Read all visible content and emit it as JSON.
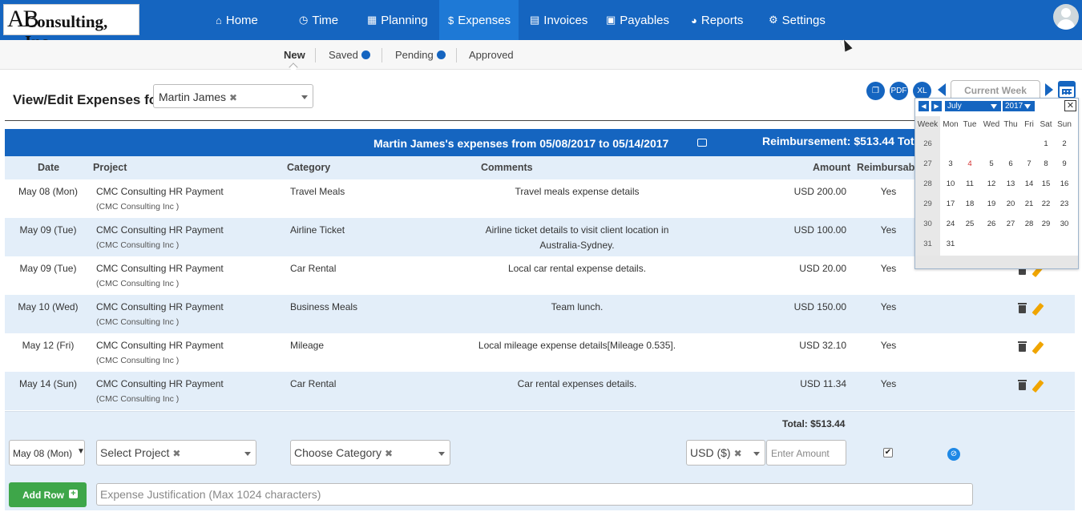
{
  "logo": {
    "initials": "AB",
    "name": "Consulting, Inc."
  },
  "nav": {
    "items": [
      {
        "label": "Home",
        "icon": "home-icon",
        "glyph": "⌂"
      },
      {
        "label": "Time",
        "icon": "clock-icon",
        "glyph": "◷"
      },
      {
        "label": "Planning",
        "icon": "calendar-check-icon",
        "glyph": "▦"
      },
      {
        "label": "Expenses",
        "icon": "dollar-icon",
        "glyph": "$"
      },
      {
        "label": "Invoices",
        "icon": "file-icon",
        "glyph": "▤"
      },
      {
        "label": "Payables",
        "icon": "money-icon",
        "glyph": "▣"
      },
      {
        "label": "Reports",
        "icon": "pie-chart-icon",
        "glyph": "◕"
      },
      {
        "label": "Settings",
        "icon": "gears-icon",
        "glyph": "⚙"
      }
    ],
    "active": "Expenses"
  },
  "subtabs": [
    {
      "label": "New"
    },
    {
      "label": "Saved"
    },
    {
      "label": "Pending"
    },
    {
      "label": "Approved"
    }
  ],
  "page": {
    "heading": "View/Edit Expenses for",
    "employee": "Martin James",
    "week_label": "Current Week"
  },
  "toolbar": {
    "copy_icon": "copy-icon",
    "pdf_icon": "pdf-icon",
    "excel_icon": "excel-icon"
  },
  "banner": {
    "title": "Martin James's expenses from  05/08/2017 to 05/14/2017",
    "reimbursement": "Reimbursement: $513.44  Tot"
  },
  "columns": [
    "Date",
    "Project",
    "Category",
    "Comments",
    "Amount",
    "Reimbursable"
  ],
  "rows": [
    {
      "date": "May 08 (Mon)",
      "project": "CMC Consulting HR Payment",
      "client": "(CMC Consulting Inc )",
      "category": "Travel Meals",
      "comment": "Travel meals expense details",
      "amount": "USD 200.00",
      "reimbursable": "Yes"
    },
    {
      "date": "May 09 (Tue)",
      "project": "CMC Consulting HR Payment",
      "client": "(CMC Consulting Inc )",
      "category": "Airline Ticket",
      "comment": "Airline ticket details to visit client location in Australia-Sydney.",
      "amount": "USD 100.00",
      "reimbursable": "Yes"
    },
    {
      "date": "May 09 (Tue)",
      "project": "CMC Consulting HR Payment",
      "client": "(CMC Consulting Inc )",
      "category": "Car Rental",
      "comment": "Local car rental expense details.",
      "amount": "USD 20.00",
      "reimbursable": "Yes"
    },
    {
      "date": "May 10 (Wed)",
      "project": "CMC Consulting HR Payment",
      "client": "(CMC Consulting Inc )",
      "category": "Business Meals",
      "comment": "Team lunch.",
      "amount": "USD 150.00",
      "reimbursable": "Yes"
    },
    {
      "date": "May 12 (Fri)",
      "project": "CMC Consulting HR Payment",
      "client": "(CMC Consulting Inc )",
      "category": "Mileage",
      "comment": "Local mileage expense details[Mileage 0.535].",
      "amount": "USD 32.10",
      "reimbursable": "Yes"
    },
    {
      "date": "May 14 (Sun)",
      "project": "CMC Consulting HR Payment",
      "client": "(CMC Consulting Inc )",
      "category": "Car Rental",
      "comment": "Car rental expenses details.",
      "amount": "USD 11.34",
      "reimbursable": "Yes"
    }
  ],
  "total": "Total: $513.44",
  "entry": {
    "date_value": "May 08 (Mon)",
    "project_placeholder": "Select Project",
    "category_placeholder": "Choose Category",
    "currency": "USD ($)",
    "amount_placeholder": "Enter Amount",
    "reimbursable_checked": "✔",
    "add_row": "Add Row",
    "justification_placeholder": "Expense Justification (Max 1024 characters)"
  },
  "datepicker": {
    "month": "July",
    "year": "2017",
    "days_header": [
      "Week",
      "Mon",
      "Tue",
      "Wed",
      "Thu",
      "Fri",
      "Sat",
      "Sun"
    ],
    "weeks": [
      {
        "week": "26",
        "days": [
          "",
          "",
          "",
          "",
          "",
          "1",
          "2"
        ]
      },
      {
        "week": "27",
        "days": [
          "3",
          "4",
          "5",
          "6",
          "7",
          "8",
          "9"
        ]
      },
      {
        "week": "28",
        "days": [
          "10",
          "11",
          "12",
          "13",
          "14",
          "15",
          "16"
        ]
      },
      {
        "week": "29",
        "days": [
          "17",
          "18",
          "19",
          "20",
          "21",
          "22",
          "23"
        ]
      },
      {
        "week": "30",
        "days": [
          "24",
          "25",
          "26",
          "27",
          "28",
          "29",
          "30"
        ]
      },
      {
        "week": "31",
        "days": [
          "31",
          "",
          "",
          "",
          "",
          "",
          ""
        ]
      }
    ],
    "highlight_day": "4",
    "highlight_color": "#d32f2f",
    "close": "✕"
  },
  "colors": {
    "primary": "#1565c0",
    "row_alt": "#e3eef9",
    "add_button": "#3ea649"
  }
}
